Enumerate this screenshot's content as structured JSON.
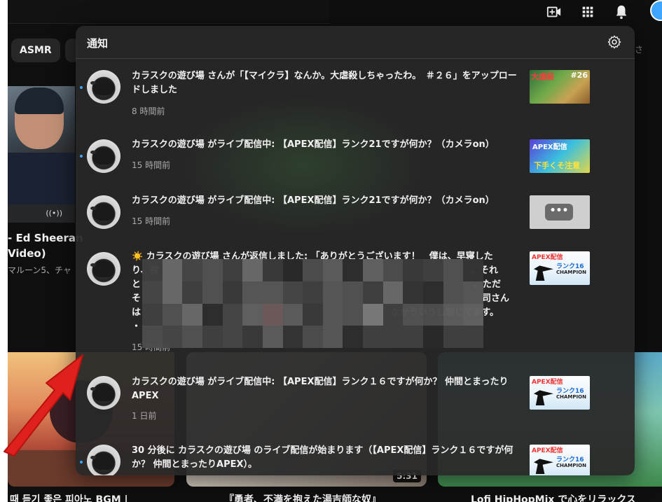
{
  "background": {
    "chips": [
      "ASMR"
    ],
    "video1": {
      "title_line1": "- Ed Sheeran",
      "title_line2": "Video)",
      "channel": "マルーン5、チャ"
    },
    "durations": [
      "5:31"
    ],
    "bottom_titles": [
      "때 듣기 좋은 피아노 BGM |",
      "『勇者、不満を抱えた湯吉師な奴』",
      "Lofi HipHopMix で心をリラックス"
    ],
    "search_hint": "さ"
  },
  "panel": {
    "title": "通知",
    "notifications": [
      {
        "text": "カラスクの遊び場 さんが「【マイクラ】なんか。大虐殺しちゃったわ。　＃２６」をアップロードしました",
        "time": "8 時間前",
        "thumb": {
          "label1": "大虐殺",
          "label2": "#26"
        }
      },
      {
        "text": "カラスクの遊び場 がライブ配信中: 【APEX配信】ランク21ですが何か？（カメラon）",
        "time": "15 時間前",
        "thumb": {
          "label1": "APEX配信",
          "label2": "下手くそ注意"
        }
      },
      {
        "text": "カラスクの遊び場 がライブ配信中: 【APEX配信】ランク21ですが何か？（カメラon）",
        "time": "15 時間前",
        "thumb": {
          "label1": "•••"
        }
      },
      {
        "text": "☀️ カラスクの遊び場 さんが返信しました: 「ありがとうございます！　僕は、早寝したり、夜",
        "line2_end": "。それ",
        "line3_start": "と",
        "line3_end": "。ただ",
        "line4_start": "そ",
        "line4_end": "司さん",
        "line5_start": "は",
        "line5_end": "なかういうし感じてます。",
        "line6_start": "・",
        "time": "15 時間前",
        "thumb": {
          "label1": "APEX配信",
          "label2": "ランク16",
          "label3": "CHAMPION"
        }
      },
      {
        "text": "カラスクの遊び場 がライブ配信中: 【APEX配信】ランク１６ですが何か？ 仲間とまったりAPEX",
        "time": "1 日前",
        "thumb": {
          "label1": "APEX配信",
          "label2": "ランク16",
          "label3": "CHAMPION"
        }
      },
      {
        "text": "30 分後に カラスクの遊び場 のライブ配信が始まります（【APEX配信】ランク１６ですが何か？ 仲間とまったりAPEX）。",
        "time": "",
        "thumb": {
          "label1": "APEX配信",
          "label2": "ランク16",
          "label3": "CHAMPION"
        }
      }
    ]
  },
  "colors": {
    "accent_blue": "#3ea6ff",
    "panel_bg": "#282828",
    "arrow_red": "#e0201c"
  },
  "icons": [
    "create-video-icon",
    "apps-grid-icon",
    "bell-icon",
    "settings-gear-icon",
    "live-radio-icon"
  ]
}
